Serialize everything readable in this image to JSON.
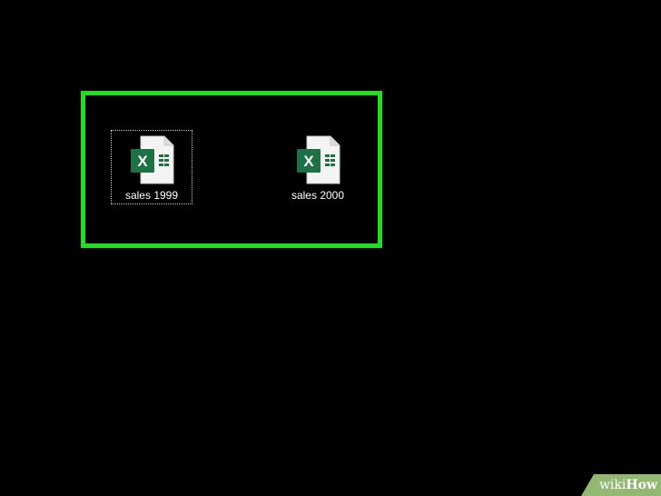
{
  "desktop": {
    "files": [
      {
        "name": "sales 1999",
        "icon": "excel-file-icon",
        "selected": true
      },
      {
        "name": "sales 2000",
        "icon": "excel-file-icon",
        "selected": false
      }
    ]
  },
  "watermark": {
    "part1": "wiki",
    "part2": "How"
  },
  "colors": {
    "highlight": "#1ee01e",
    "excel_green": "#1e7145",
    "background": "#000000",
    "watermark": "#93b874"
  }
}
